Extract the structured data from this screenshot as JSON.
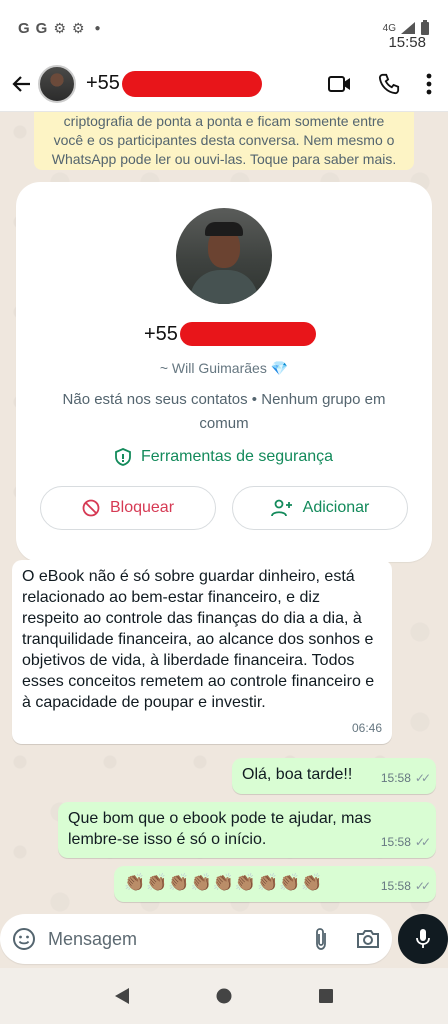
{
  "status_bar": {
    "time": "15:58",
    "left_icons": [
      "G",
      "G"
    ],
    "network": "4G"
  },
  "header": {
    "contact_phone_prefix": "+55",
    "icons": [
      "back-arrow-icon",
      "video-call-icon",
      "phone-icon",
      "more-vert-icon"
    ]
  },
  "encryption_notice": {
    "line1": "criptografia de ponta a ponta e ficam somente entre",
    "line2": "você e os participantes desta conversa. Nem mesmo o",
    "line3": "WhatsApp pode ler ou ouvi-las. Toque para saber mais."
  },
  "profile": {
    "phone_prefix": "+55",
    "alias": "~ Will Guimarães 💎",
    "info": "Não está nos seus contatos • Nenhum grupo em comum",
    "security_label": "Ferramentas de segurança",
    "block_label": "Bloquear",
    "add_label": "Adicionar"
  },
  "messages": [
    {
      "direction": "incoming",
      "text": "O eBook não é só sobre guardar dinheiro, está relacionado ao bem-estar financeiro, e diz respeito ao controle das finanças do dia a dia, à tranquilidade financeira, ao alcance dos sonhos e objetivos de vida, à liberdade financeira. Todos esses conceitos remetem ao controle financeiro e à capacidade de poupar e investir.",
      "time": "06:46"
    },
    {
      "direction": "outgoing",
      "text": "Olá, boa tarde!!",
      "time": "15:58",
      "status": "read"
    },
    {
      "direction": "outgoing",
      "text": "Que bom que o ebook pode te ajudar, mas lembre-se isso é só o início.",
      "time": "15:58",
      "status": "read"
    },
    {
      "direction": "outgoing",
      "text": "👏🏽👏🏽👏🏽👏🏽👏🏽👏🏽👏🏽👏🏽👏🏽",
      "time": "15:58",
      "status": "read"
    }
  ],
  "composer": {
    "placeholder": "Mensagem"
  },
  "colors": {
    "accent_green": "#138a5b",
    "outgoing_bubble": "#d9fdd3",
    "block_red": "#d63a54",
    "redaction": "#e8151a"
  }
}
